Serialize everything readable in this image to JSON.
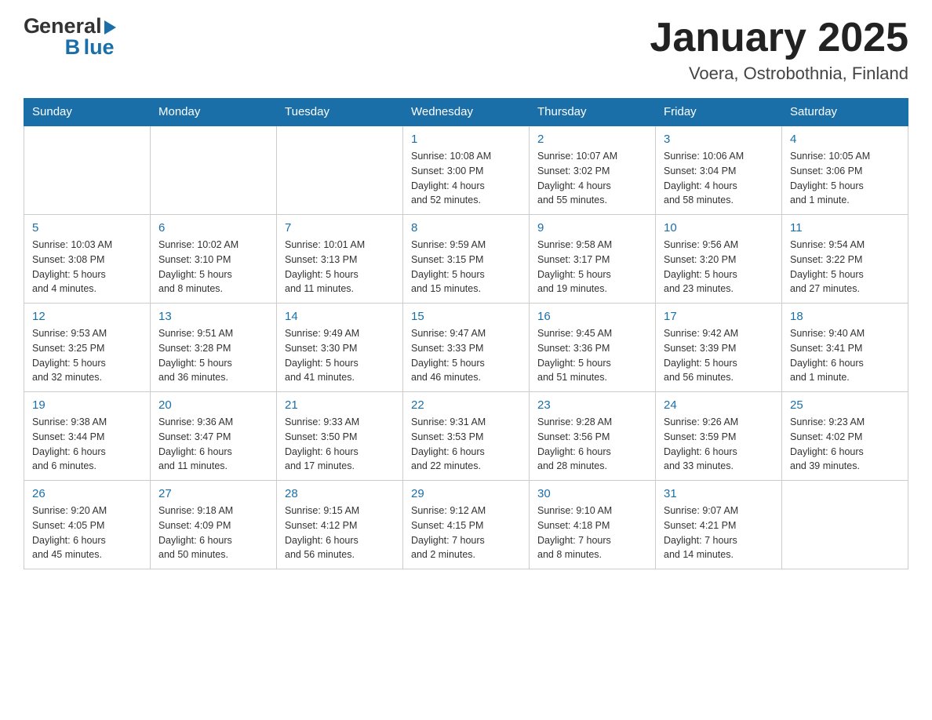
{
  "header": {
    "title": "January 2025",
    "subtitle": "Voera, Ostrobothnia, Finland",
    "logo_general": "General",
    "logo_blue": "Blue"
  },
  "calendar": {
    "days_of_week": [
      "Sunday",
      "Monday",
      "Tuesday",
      "Wednesday",
      "Thursday",
      "Friday",
      "Saturday"
    ],
    "weeks": [
      [
        {
          "day": "",
          "info": ""
        },
        {
          "day": "",
          "info": ""
        },
        {
          "day": "",
          "info": ""
        },
        {
          "day": "1",
          "info": "Sunrise: 10:08 AM\nSunset: 3:00 PM\nDaylight: 4 hours\nand 52 minutes."
        },
        {
          "day": "2",
          "info": "Sunrise: 10:07 AM\nSunset: 3:02 PM\nDaylight: 4 hours\nand 55 minutes."
        },
        {
          "day": "3",
          "info": "Sunrise: 10:06 AM\nSunset: 3:04 PM\nDaylight: 4 hours\nand 58 minutes."
        },
        {
          "day": "4",
          "info": "Sunrise: 10:05 AM\nSunset: 3:06 PM\nDaylight: 5 hours\nand 1 minute."
        }
      ],
      [
        {
          "day": "5",
          "info": "Sunrise: 10:03 AM\nSunset: 3:08 PM\nDaylight: 5 hours\nand 4 minutes."
        },
        {
          "day": "6",
          "info": "Sunrise: 10:02 AM\nSunset: 3:10 PM\nDaylight: 5 hours\nand 8 minutes."
        },
        {
          "day": "7",
          "info": "Sunrise: 10:01 AM\nSunset: 3:13 PM\nDaylight: 5 hours\nand 11 minutes."
        },
        {
          "day": "8",
          "info": "Sunrise: 9:59 AM\nSunset: 3:15 PM\nDaylight: 5 hours\nand 15 minutes."
        },
        {
          "day": "9",
          "info": "Sunrise: 9:58 AM\nSunset: 3:17 PM\nDaylight: 5 hours\nand 19 minutes."
        },
        {
          "day": "10",
          "info": "Sunrise: 9:56 AM\nSunset: 3:20 PM\nDaylight: 5 hours\nand 23 minutes."
        },
        {
          "day": "11",
          "info": "Sunrise: 9:54 AM\nSunset: 3:22 PM\nDaylight: 5 hours\nand 27 minutes."
        }
      ],
      [
        {
          "day": "12",
          "info": "Sunrise: 9:53 AM\nSunset: 3:25 PM\nDaylight: 5 hours\nand 32 minutes."
        },
        {
          "day": "13",
          "info": "Sunrise: 9:51 AM\nSunset: 3:28 PM\nDaylight: 5 hours\nand 36 minutes."
        },
        {
          "day": "14",
          "info": "Sunrise: 9:49 AM\nSunset: 3:30 PM\nDaylight: 5 hours\nand 41 minutes."
        },
        {
          "day": "15",
          "info": "Sunrise: 9:47 AM\nSunset: 3:33 PM\nDaylight: 5 hours\nand 46 minutes."
        },
        {
          "day": "16",
          "info": "Sunrise: 9:45 AM\nSunset: 3:36 PM\nDaylight: 5 hours\nand 51 minutes."
        },
        {
          "day": "17",
          "info": "Sunrise: 9:42 AM\nSunset: 3:39 PM\nDaylight: 5 hours\nand 56 minutes."
        },
        {
          "day": "18",
          "info": "Sunrise: 9:40 AM\nSunset: 3:41 PM\nDaylight: 6 hours\nand 1 minute."
        }
      ],
      [
        {
          "day": "19",
          "info": "Sunrise: 9:38 AM\nSunset: 3:44 PM\nDaylight: 6 hours\nand 6 minutes."
        },
        {
          "day": "20",
          "info": "Sunrise: 9:36 AM\nSunset: 3:47 PM\nDaylight: 6 hours\nand 11 minutes."
        },
        {
          "day": "21",
          "info": "Sunrise: 9:33 AM\nSunset: 3:50 PM\nDaylight: 6 hours\nand 17 minutes."
        },
        {
          "day": "22",
          "info": "Sunrise: 9:31 AM\nSunset: 3:53 PM\nDaylight: 6 hours\nand 22 minutes."
        },
        {
          "day": "23",
          "info": "Sunrise: 9:28 AM\nSunset: 3:56 PM\nDaylight: 6 hours\nand 28 minutes."
        },
        {
          "day": "24",
          "info": "Sunrise: 9:26 AM\nSunset: 3:59 PM\nDaylight: 6 hours\nand 33 minutes."
        },
        {
          "day": "25",
          "info": "Sunrise: 9:23 AM\nSunset: 4:02 PM\nDaylight: 6 hours\nand 39 minutes."
        }
      ],
      [
        {
          "day": "26",
          "info": "Sunrise: 9:20 AM\nSunset: 4:05 PM\nDaylight: 6 hours\nand 45 minutes."
        },
        {
          "day": "27",
          "info": "Sunrise: 9:18 AM\nSunset: 4:09 PM\nDaylight: 6 hours\nand 50 minutes."
        },
        {
          "day": "28",
          "info": "Sunrise: 9:15 AM\nSunset: 4:12 PM\nDaylight: 6 hours\nand 56 minutes."
        },
        {
          "day": "29",
          "info": "Sunrise: 9:12 AM\nSunset: 4:15 PM\nDaylight: 7 hours\nand 2 minutes."
        },
        {
          "day": "30",
          "info": "Sunrise: 9:10 AM\nSunset: 4:18 PM\nDaylight: 7 hours\nand 8 minutes."
        },
        {
          "day": "31",
          "info": "Sunrise: 9:07 AM\nSunset: 4:21 PM\nDaylight: 7 hours\nand 14 minutes."
        },
        {
          "day": "",
          "info": ""
        }
      ]
    ]
  }
}
